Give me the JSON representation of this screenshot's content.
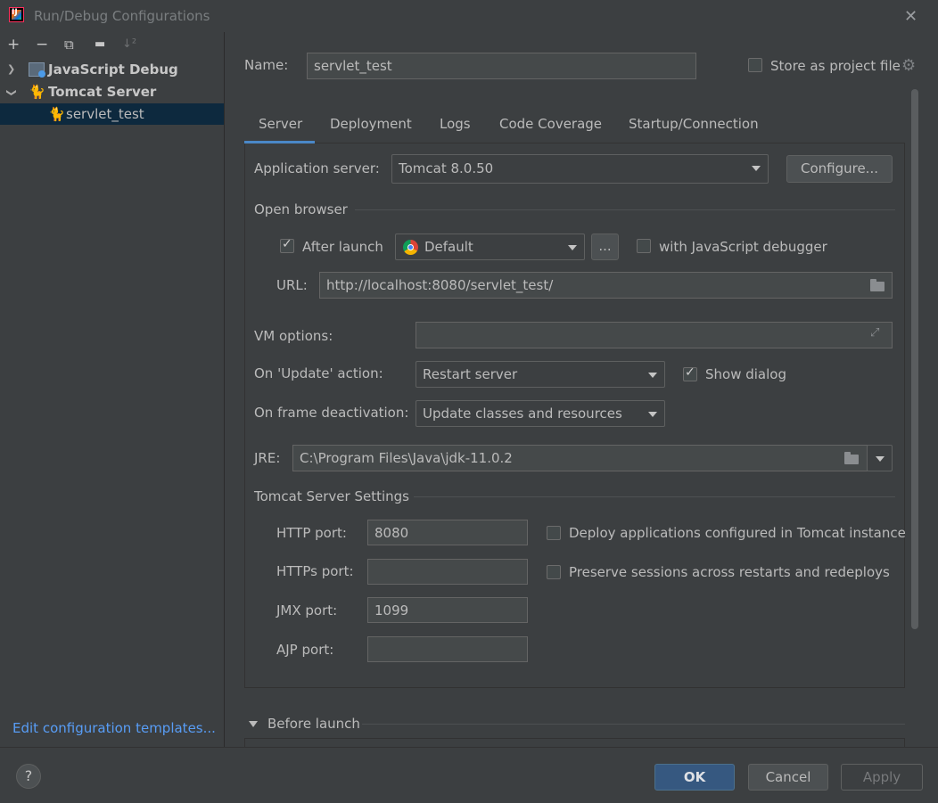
{
  "window": {
    "title": "Run/Debug Configurations",
    "close_glyph": "✕"
  },
  "toolbar": {
    "add": "+",
    "remove": "−",
    "copy": "⧉",
    "folder": "▬",
    "sort": "↓²"
  },
  "tree": {
    "items": [
      {
        "label": "JavaScript Debug",
        "icon": "javascript-debug-icon",
        "expanded": false
      },
      {
        "label": "Tomcat Server",
        "icon": "tomcat-icon",
        "expanded": true
      },
      {
        "label": "servlet_test",
        "icon": "tomcat-icon",
        "selected": true
      }
    ]
  },
  "edit_templates_link": "Edit configuration templates...",
  "name": {
    "label": "Name:",
    "value": "servlet_test"
  },
  "store_project_file": {
    "label": "Store as project file",
    "checked": false
  },
  "tabs": [
    "Server",
    "Deployment",
    "Logs",
    "Code Coverage",
    "Startup/Connection"
  ],
  "active_tab": "Server",
  "server": {
    "app_server_label": "Application server:",
    "app_server_value": "Tomcat 8.0.50",
    "configure_label": "Configure...",
    "open_browser_title": "Open browser",
    "after_launch_label": "After launch",
    "after_launch_checked": true,
    "browser_value": "Default",
    "browse_label": "...",
    "js_debugger_label": "with JavaScript debugger",
    "js_debugger_checked": false,
    "url_label": "URL:",
    "url_value": "http://localhost:8080/servlet_test/",
    "vm_options_label": "VM options:",
    "vm_options_value": "",
    "on_update_label": "On 'Update' action:",
    "on_update_value": "Restart server",
    "show_dialog_label": "Show dialog",
    "show_dialog_checked": true,
    "on_frame_label": "On frame deactivation:",
    "on_frame_value": "Update classes and resources",
    "jre_label": "JRE:",
    "jre_value": "C:\\Program Files\\Java\\jdk-11.0.2",
    "tomcat_settings_title": "Tomcat Server Settings",
    "http_port_label": "HTTP port:",
    "http_port_value": "8080",
    "https_port_label": "HTTPs port:",
    "https_port_value": "",
    "jmx_port_label": "JMX port:",
    "jmx_port_value": "1099",
    "ajp_port_label": "AJP port:",
    "ajp_port_value": "",
    "deploy_apps_label": "Deploy applications configured in Tomcat instance",
    "deploy_apps_checked": false,
    "preserve_sessions_label": "Preserve sessions across restarts and redeploys",
    "preserve_sessions_checked": false
  },
  "before_launch": {
    "label": "Before launch",
    "expanded": true
  },
  "footer": {
    "help": "?",
    "ok": "OK",
    "cancel": "Cancel",
    "apply": "Apply"
  },
  "colors": {
    "accent": "#4a88c7",
    "ok_button": "#365880",
    "link": "#589df6",
    "selection": "#0d293e"
  }
}
